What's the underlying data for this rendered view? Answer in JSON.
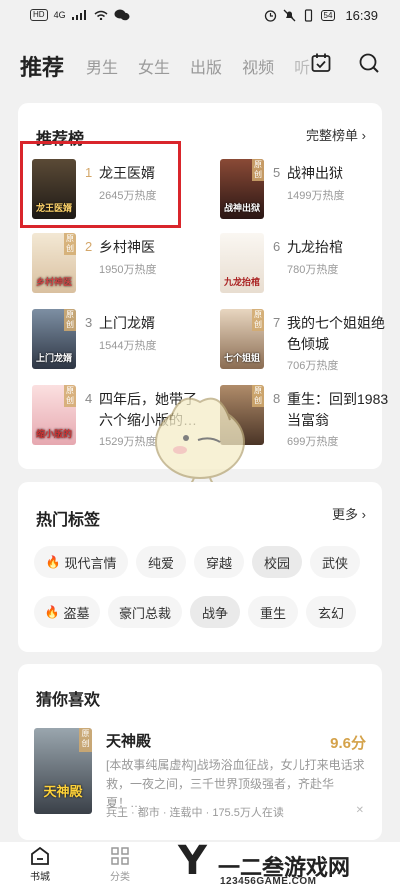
{
  "status_bar": {
    "left_badge": "HD",
    "network": "4G",
    "battery": "54",
    "time": "16:39"
  },
  "header": {
    "tabs": [
      {
        "label": "推荐",
        "active": true
      },
      {
        "label": "男生"
      },
      {
        "label": "女生"
      },
      {
        "label": "出版"
      },
      {
        "label": "视频"
      },
      {
        "label": "听"
      }
    ]
  },
  "ranking": {
    "title": "推荐榜",
    "more_label": "完整榜单",
    "items": [
      {
        "rank": "1",
        "name": "龙王医婿",
        "heat": "2645万热度",
        "cover_text": "龙王医婿",
        "tag": "",
        "cover_color": "#3a3024"
      },
      {
        "rank": "2",
        "name": "乡村神医",
        "heat": "1950万热度",
        "cover_text": "乡村神医",
        "tag": "原创",
        "cover_color": "#e9dcc6"
      },
      {
        "rank": "3",
        "name": "上门龙婿",
        "heat": "1544万热度",
        "cover_text": "上门龙婿",
        "tag": "原创",
        "cover_color": "#4c5766"
      },
      {
        "rank": "4",
        "name": "四年后，她带了六个缩小版的…",
        "heat": "1529万热度",
        "cover_text": "缩小版的",
        "tag": "原创",
        "cover_color": "#f0c8c8"
      },
      {
        "rank": "5",
        "name": "战神出狱",
        "heat": "1499万热度",
        "cover_text": "战神出狱",
        "tag": "原创",
        "cover_color": "#4a2a22"
      },
      {
        "rank": "6",
        "name": "九龙抬棺",
        "heat": "780万热度",
        "cover_text": "九龙抬棺",
        "tag": "",
        "cover_color": "#f4f0ea"
      },
      {
        "rank": "7",
        "name": "我的七个姐姐绝色倾城",
        "heat": "706万热度",
        "cover_text": "七个姐姐",
        "tag": "原创",
        "cover_color": "#d8c2a8"
      },
      {
        "rank": "8",
        "name": "重生：回到1983当富翁",
        "heat": "699万热度",
        "cover_text": "",
        "tag": "原创",
        "cover_color": "#8a6a4e"
      }
    ]
  },
  "hot_tags": {
    "title": "热门标签",
    "more_label": "更多",
    "row1": [
      "现代言情",
      "纯爱",
      "穿越",
      "校园",
      "武侠"
    ],
    "row2": [
      "盗墓",
      "豪门总裁",
      "战争",
      "重生",
      "玄幻"
    ]
  },
  "guess": {
    "title": "猜你喜欢",
    "book": {
      "title": "天神殿",
      "score": "9.6分",
      "tag": "原创",
      "cover_text": "天神殿",
      "desc": "[本故事纯属虚构]战场浴血征战，女儿打来电话求救，一夜之间，三千世界顶级强者，齐赴华夏！…",
      "meta": "兵王 · 都市 · 连载中 · 175.5万人在读"
    }
  },
  "bottom_nav": {
    "items": [
      {
        "label": "书城",
        "icon": "home-icon",
        "active": true
      },
      {
        "label": "分类",
        "icon": "grid-icon"
      }
    ]
  },
  "watermark": {
    "letter": "Y",
    "name": "一二叁游戏网",
    "url": "123456GAME.COM"
  },
  "colors": {
    "accent_gold": "#d4a76a",
    "highlight_red": "#d9252b",
    "fire": "#e07a36"
  }
}
